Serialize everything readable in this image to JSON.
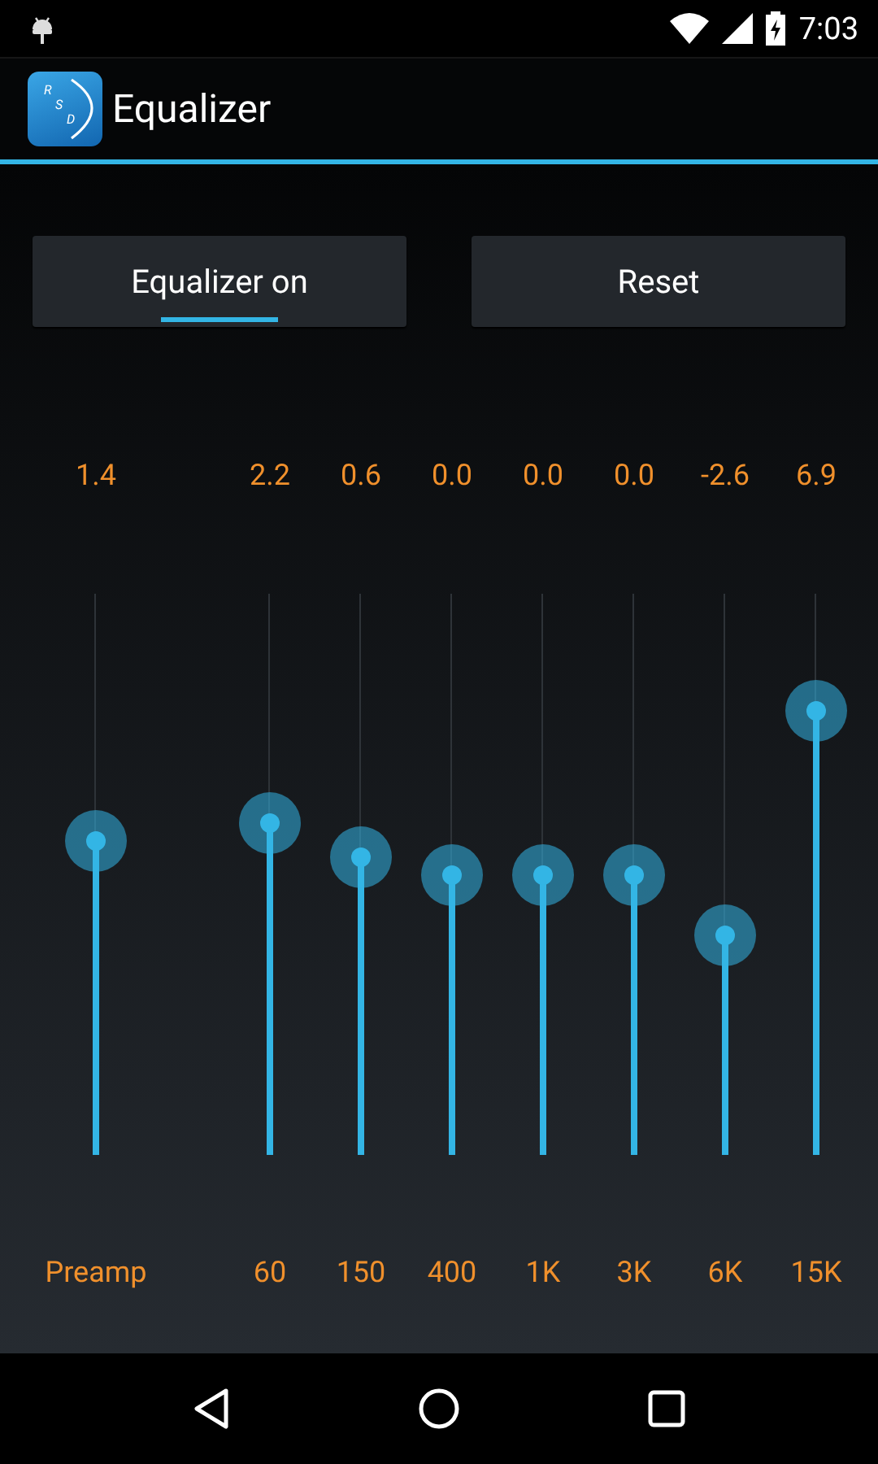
{
  "status_bar": {
    "time": "7:03"
  },
  "app_bar": {
    "title": "Equalizer",
    "logo_letters": [
      "R",
      "S",
      "D"
    ]
  },
  "buttons": [
    {
      "label": "Equalizer on",
      "kind": "toggle",
      "on": true
    },
    {
      "label": "Reset",
      "kind": "action"
    }
  ],
  "preamp": {
    "label": "Preamp",
    "reading": "1.4",
    "level": 0.56
  },
  "bands": [
    {
      "label": "60",
      "reading": "2.2",
      "level": 0.59
    },
    {
      "label": "150",
      "reading": "0.6",
      "level": 0.53
    },
    {
      "label": "400",
      "reading": "0.0",
      "level": 0.5
    },
    {
      "label": "1K",
      "reading": "0.0",
      "level": 0.5
    },
    {
      "label": "3K",
      "reading": "0.0",
      "level": 0.5
    },
    {
      "label": "6K",
      "reading": "-2.6",
      "level": 0.39
    },
    {
      "label": "15K",
      "reading": "6.9",
      "level": 0.79
    }
  ]
}
